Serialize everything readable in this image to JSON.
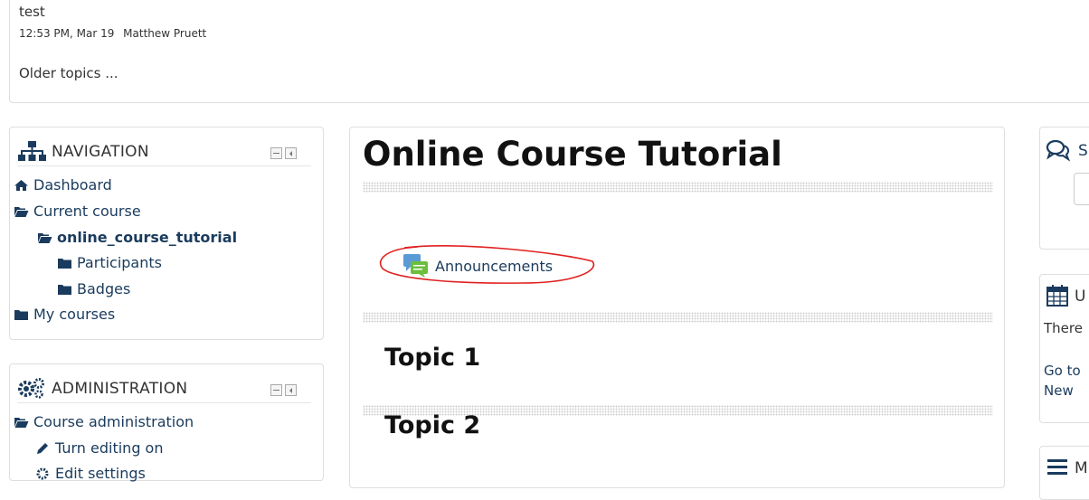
{
  "forum_post": {
    "title": "test",
    "time": "12:53 PM, Mar 19",
    "author": "Matthew Pruett",
    "older_link": "Older topics ..."
  },
  "navigation": {
    "title": "NAVIGATION",
    "items": [
      {
        "label": "Dashboard",
        "icon": "home-icon"
      },
      {
        "label": "Current course",
        "icon": "folder-open-icon"
      },
      {
        "label": "online_course_tutorial",
        "icon": "folder-open-icon"
      },
      {
        "label": "Participants",
        "icon": "folder-icon"
      },
      {
        "label": "Badges",
        "icon": "folder-icon"
      },
      {
        "label": "My courses",
        "icon": "folder-icon"
      }
    ]
  },
  "administration": {
    "title": "ADMINISTRATION",
    "items": [
      {
        "label": "Course administration",
        "icon": "folder-open-icon"
      },
      {
        "label": "Turn editing on",
        "icon": "pencil-icon"
      },
      {
        "label": "Edit settings",
        "icon": "gear-icon"
      }
    ]
  },
  "course": {
    "title": "Online Course Tutorial",
    "activity": "Announcements",
    "topics": [
      "Topic 1",
      "Topic 2"
    ]
  },
  "right_blocks": {
    "search_title": "S",
    "upcoming_title": "U",
    "upcoming_line1": "There",
    "upcoming_line2": "Go to",
    "upcoming_line3": "New",
    "menu_title": "M"
  },
  "colors": {
    "link": "#1a3b5d",
    "annotation": "#e02020",
    "border": "#dedede"
  }
}
